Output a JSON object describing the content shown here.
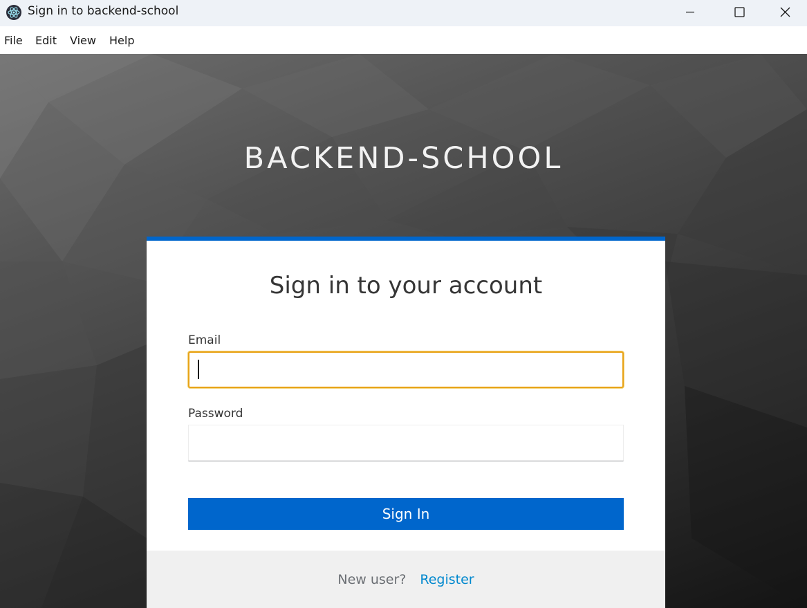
{
  "window": {
    "title": "Sign in to backend-school",
    "icon": "electron-atom-icon",
    "controls": [
      "minimize-icon",
      "maximize-icon",
      "close-icon"
    ]
  },
  "menu": {
    "file": "File",
    "edit": "Edit",
    "view": "View",
    "help": "Help"
  },
  "brand": {
    "name": "BACKEND-SCHOOL"
  },
  "login": {
    "heading": "Sign in to your account",
    "email_label": "Email",
    "email_value": "",
    "password_label": "Password",
    "password_value": "",
    "submit_label": "Sign In",
    "new_user_text": "New user?",
    "register_link": "Register"
  },
  "colors": {
    "accent": "#0066cc",
    "focus_border": "#e8a317",
    "link": "#0088ce",
    "footer_bg": "#f0f0f0"
  }
}
